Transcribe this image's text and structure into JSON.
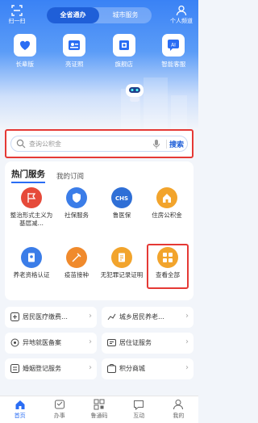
{
  "header": {
    "scan_label": "扫一扫",
    "segments": [
      "全省通办",
      "城市服务"
    ],
    "personal_label": "个人频道"
  },
  "quick_links": [
    {
      "label": "长辈版",
      "icon": "elder-heart-icon"
    },
    {
      "label": "亮证照",
      "icon": "id-card-icon"
    },
    {
      "label": "旗舰店",
      "icon": "store-icon"
    },
    {
      "label": "智能客服",
      "icon": "ai-chat-icon"
    }
  ],
  "search": {
    "placeholder": "查询公积金",
    "button": "搜索"
  },
  "services": {
    "tab_active": "热门服务",
    "tab_other": "我的订阅",
    "items": [
      {
        "label": "整治形式主义为基层减…",
        "icon": "flag-icon",
        "color": "#e64a3a"
      },
      {
        "label": "社保服务",
        "icon": "shield-icon",
        "color": "#3b7de8"
      },
      {
        "label": "鲁医保",
        "icon": "chs-icon",
        "color": "#2f6fd6"
      },
      {
        "label": "住房公积金",
        "icon": "house-icon",
        "color": "#f2a42c"
      },
      {
        "label": "养老资格认证",
        "icon": "certificate-icon",
        "color": "#3b7de8"
      },
      {
        "label": "疫苗接种",
        "icon": "vaccine-icon",
        "color": "#f08a2c"
      },
      {
        "label": "无犯罪记录证明",
        "icon": "record-icon",
        "color": "#f2a42c"
      },
      {
        "label": "查看全部",
        "icon": "grid-icon",
        "color": "#f2a42c"
      }
    ]
  },
  "shortcuts": [
    {
      "label": "居民医疗缴费…",
      "icon": "medical-plus-icon"
    },
    {
      "label": "城乡居民养老…",
      "icon": "pension-icon"
    },
    {
      "label": "异地就医备案",
      "icon": "location-icon"
    },
    {
      "label": "居住证服务",
      "icon": "residence-card-icon"
    },
    {
      "label": "婚姻登记服务",
      "icon": "marriage-icon"
    },
    {
      "label": "积分商城",
      "icon": "points-mall-icon"
    }
  ],
  "tabbar": [
    {
      "label": "首页",
      "icon": "home-icon",
      "active": true
    },
    {
      "label": "办事",
      "icon": "task-icon",
      "active": false
    },
    {
      "label": "鲁通码",
      "icon": "qr-code-icon",
      "active": false
    },
    {
      "label": "互动",
      "icon": "chat-icon",
      "active": false
    },
    {
      "label": "我的",
      "icon": "user-icon",
      "active": false
    }
  ],
  "colors": {
    "primary": "#2a6df4",
    "highlight_border": "#e53935"
  }
}
